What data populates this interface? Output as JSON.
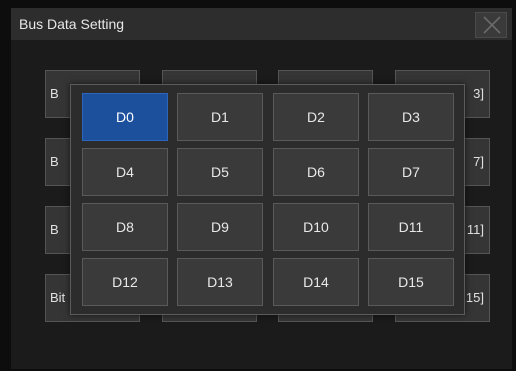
{
  "dialog": {
    "title": "Bus Data Setting"
  },
  "bit_buttons": {
    "row1": {
      "left": "B",
      "right": "3]"
    },
    "row2": {
      "left": "B",
      "right": "7]"
    },
    "row3": {
      "left": "B",
      "right": "11]"
    },
    "row4": {
      "left": "Bit",
      "right": "15]"
    }
  },
  "popup": {
    "selected": "D0",
    "channels": [
      "D0",
      "D1",
      "D2",
      "D3",
      "D4",
      "D5",
      "D6",
      "D7",
      "D8",
      "D9",
      "D10",
      "D11",
      "D12",
      "D13",
      "D14",
      "D15"
    ]
  },
  "colors": {
    "selected": "#1c4f9c",
    "background": "#1b1b1b",
    "titlebar": "#2d2d2d"
  },
  "icons": {
    "close": "close-icon"
  }
}
